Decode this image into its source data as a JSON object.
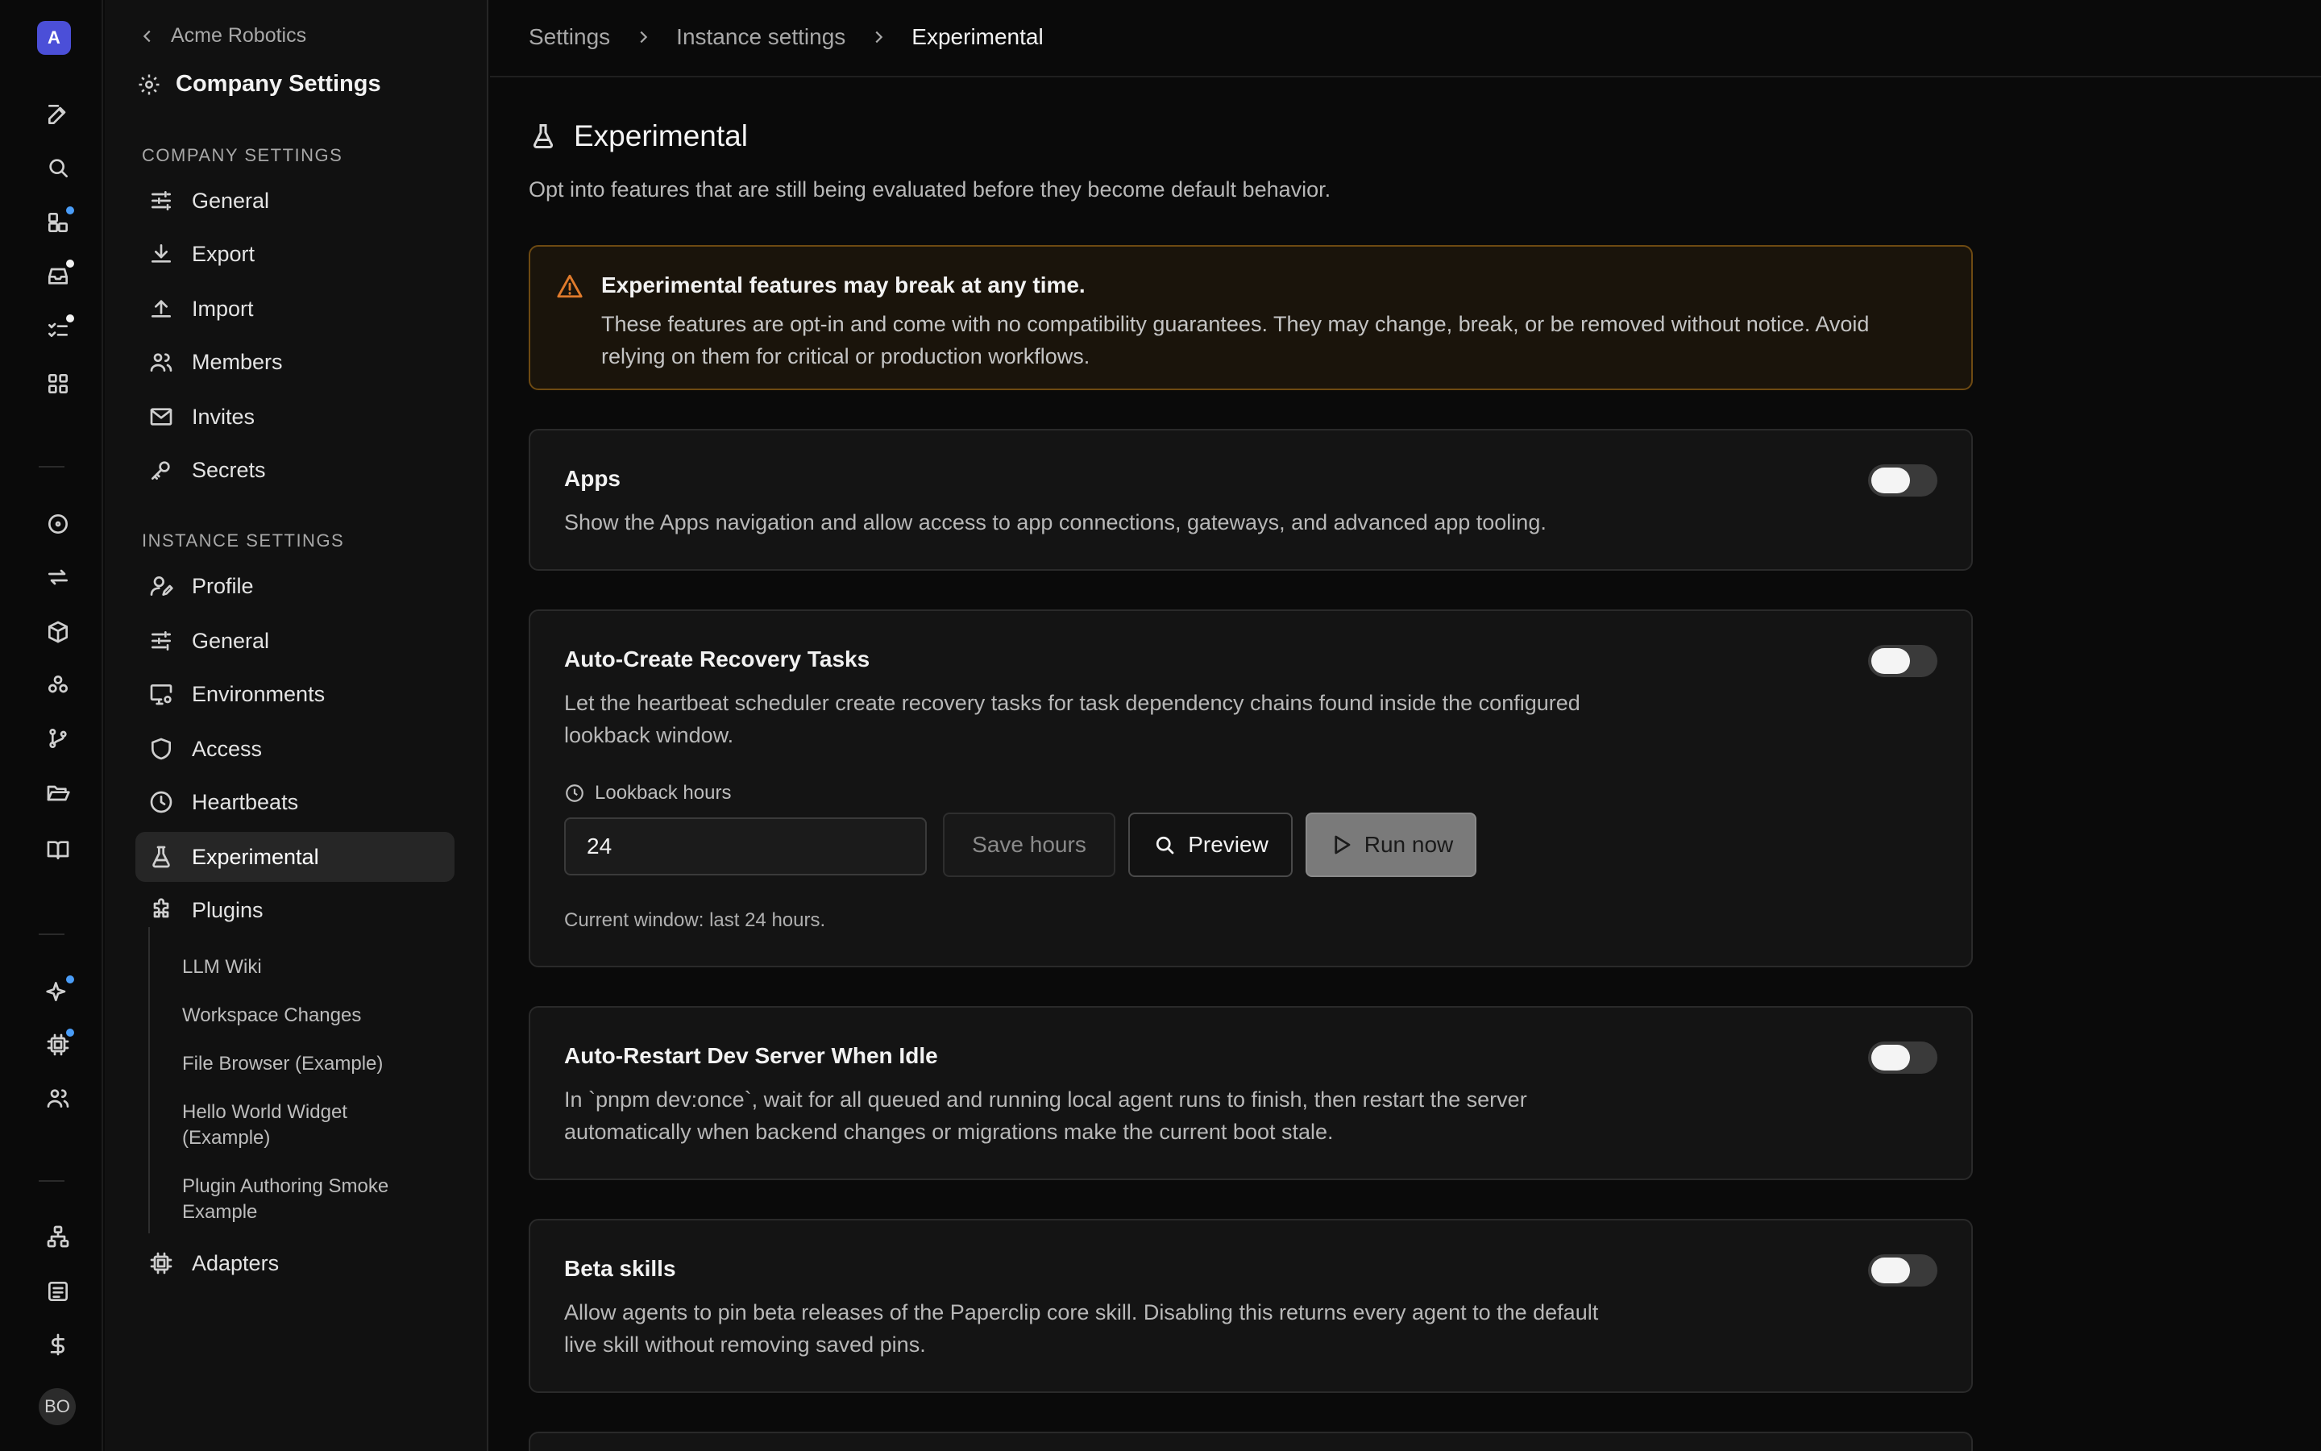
{
  "rail": {
    "company_initial": "A",
    "user_initials": "BO",
    "dot_color_blue": "#4a9df8",
    "dot_color_white": "#f2f2f2"
  },
  "sidebar": {
    "back_label": "Acme Robotics",
    "title": "Company Settings",
    "company_section_label": "Company Settings",
    "company_items": [
      {
        "label": "General",
        "icon": "sliders-icon"
      },
      {
        "label": "Export",
        "icon": "download-icon"
      },
      {
        "label": "Import",
        "icon": "upload-icon"
      },
      {
        "label": "Members",
        "icon": "users-icon"
      },
      {
        "label": "Invites",
        "icon": "mail-icon"
      },
      {
        "label": "Secrets",
        "icon": "key-icon"
      }
    ],
    "instance_section_label": "Instance Settings",
    "instance_items": [
      {
        "label": "Profile",
        "icon": "user-pen-icon"
      },
      {
        "label": "General",
        "icon": "sliders-icon"
      },
      {
        "label": "Environments",
        "icon": "monitor-cog-icon"
      },
      {
        "label": "Access",
        "icon": "shield-icon"
      },
      {
        "label": "Heartbeats",
        "icon": "clock-icon"
      },
      {
        "label": "Experimental",
        "icon": "flask-icon",
        "active": true
      },
      {
        "label": "Plugins",
        "icon": "puzzle-icon"
      }
    ],
    "plugins": [
      "LLM Wiki",
      "Workspace Changes",
      "File Browser (Example)",
      "Hello World Widget (Example)",
      "Plugin Authoring Smoke Example"
    ],
    "adapters_label": "Adapters"
  },
  "breadcrumb": {
    "items": [
      "Settings",
      "Instance settings"
    ],
    "current": "Experimental"
  },
  "page": {
    "title": "Experimental",
    "description": "Opt into features that are still being evaluated before they become default behavior."
  },
  "alert": {
    "title": "Experimental features may break at any time.",
    "body": "These features are opt-in and come with no compatibility guarantees. They may change, break, or be removed without notice. Avoid relying on them for critical or production workflows.",
    "border_color": "#6e4a12",
    "icon_color": "#e07b2c"
  },
  "features": {
    "apps": {
      "title": "Apps",
      "description": "Show the Apps navigation and allow access to app connections, gateways, and advanced app tooling.",
      "enabled": false
    },
    "recovery": {
      "title": "Auto-Create Recovery Tasks",
      "description": "Let the heartbeat scheduler create recovery tasks for task dependency chains found inside the configured lookback window.",
      "enabled": false,
      "lookback_label": "Lookback hours",
      "lookback_value": "24",
      "save_label": "Save hours",
      "preview_label": "Preview",
      "run_label": "Run now",
      "window_note": "Current window: last 24 hours."
    },
    "restart": {
      "title": "Auto-Restart Dev Server When Idle",
      "description": "In `pnpm dev:once`, wait for all queued and running local agent runs to finish, then restart the server automatically when backend changes or migrations make the current boot stale.",
      "enabled": false
    },
    "beta": {
      "title": "Beta skills",
      "description": "Allow agents to pin beta releases of the Paperclip core skill. Disabling this returns every agent to the default live skill without removing saved pins.",
      "enabled": false
    }
  }
}
